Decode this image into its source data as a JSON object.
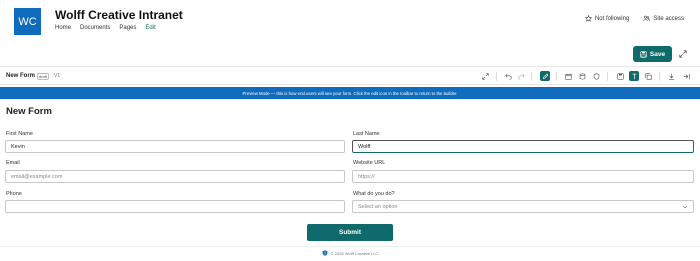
{
  "site": {
    "logo_text": "WC",
    "title": "Wolff Creative Intranet",
    "nav": [
      "Home",
      "Documents",
      "Pages",
      "Edit"
    ],
    "follow_label": "Not following",
    "access_label": "Site access"
  },
  "command_bar": {
    "save_label": "Save"
  },
  "toolbar": {
    "form_name": "New Form",
    "draft_badge": "draft",
    "version": "V1",
    "icons": [
      "expand-icon",
      "undo-icon",
      "redo-icon",
      "edit-pencil-icon",
      "calendar-icon",
      "database-icon",
      "shield-icon",
      "save-disk-icon",
      "text-format-icon",
      "copy-icon",
      "download-icon",
      "exit-icon"
    ]
  },
  "banner": {
    "text": "Preview Mode — this is how end users will see your form. Click the edit icon in the toolbar to return to the builder."
  },
  "form": {
    "title": "New Form",
    "fields": {
      "first_name": {
        "label": "First Name",
        "value": "Kevin"
      },
      "last_name": {
        "label": "Last Name",
        "value": "Wolff"
      },
      "email": {
        "label": "Email",
        "placeholder": "email@example.com"
      },
      "website": {
        "label": "Website URL",
        "placeholder": "https://"
      },
      "phone": {
        "label": "Phone",
        "value": ""
      },
      "role": {
        "label": "What do you do?",
        "placeholder": "Select an option"
      }
    },
    "submit_label": "Submit"
  },
  "footer": {
    "text": "© 2026 Wolff Creative LLC"
  },
  "colors": {
    "brand_blue": "#0f6cbd",
    "teal": "#0f6b6b"
  }
}
